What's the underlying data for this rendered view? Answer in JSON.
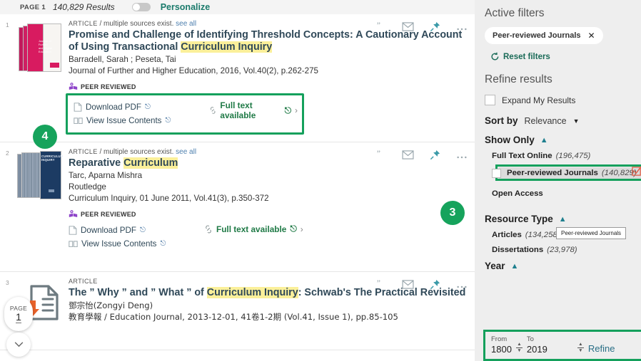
{
  "topbar": {
    "page_label": "PAGE 1",
    "results_count": "140,829 Results",
    "personalize_label": "Personalize",
    "toggle_state": "off"
  },
  "results": [
    {
      "index": "1",
      "kicker_type": "ARTICLE",
      "kicker_sep": "/ multiple sources exist.",
      "kicker_link": "see all",
      "title_pre": "Promise and Challenge of Identifying Threshold Concepts: A Cautionary Account of Using Transactional ",
      "title_highlight": "Curriculum Inquiry",
      "title_post": "",
      "authors": "Barradell, Sarah ; Peseta, Tai",
      "publisher": "",
      "source": "Journal of Further and Higher Education, 2016, Vol.40(2), p.262-275",
      "peer_reviewed_label": "PEER REVIEWED",
      "download_label": "Download PDF",
      "view_issue_label": "View Issue Contents",
      "fulltext_label": "Full text available",
      "highlighted": true
    },
    {
      "index": "2",
      "kicker_type": "ARTICLE",
      "kicker_sep": "/ multiple sources exist.",
      "kicker_link": "see all",
      "title_pre": "Reparative ",
      "title_highlight": "Curriculum",
      "title_post": "",
      "authors": "Tarc, Aparna Mishra",
      "publisher": "Routledge",
      "source": "Curriculum Inquiry, 01 June 2011, Vol.41(3), p.350-372",
      "peer_reviewed_label": "PEER REVIEWED",
      "download_label": "Download PDF",
      "view_issue_label": "View Issue Contents",
      "fulltext_label": "Full text available",
      "highlighted": false
    },
    {
      "index": "3",
      "kicker_type": "ARTICLE",
      "kicker_sep": "",
      "kicker_link": "",
      "title_pre": "The ” Why ” and ” What ” of ",
      "title_highlight": "Curriculum Inquiry",
      "title_post": ": Schwab's The Practical Revisited",
      "authors": "鄧宗怡(Zongyi Deng)",
      "publisher": "",
      "source": "教育學報 / Education Journal, 2013-12-01, 41卷1-2期 (Vol.41, Issue 1), pp.85-105",
      "peer_reviewed_label": "",
      "download_label": "",
      "view_issue_label": "",
      "fulltext_label": "",
      "highlighted": false
    }
  ],
  "annotations": {
    "badge_4": "4",
    "badge_3": "3"
  },
  "page_pill": {
    "word": "PAGE",
    "number": "1"
  },
  "sidebar": {
    "active_filters_title": "Active filters",
    "active_chip": "Peer-reviewed Journals",
    "chip_close": "✕",
    "reset_label": "Reset filters",
    "refine_title": "Refine results",
    "expand_label": "Expand My Results",
    "sort_by_label": "Sort by",
    "sort_by_value": "Relevance",
    "show_only": {
      "header": "Show Only",
      "items": [
        {
          "name": "Full Text Online",
          "count": "(196,475)",
          "selected": false,
          "highlighted": false
        },
        {
          "name": "Peer-reviewed Journals",
          "count": "(140,829)",
          "selected": true,
          "highlighted": true
        },
        {
          "name": "Open Access",
          "count": "",
          "selected": false,
          "highlighted": false
        }
      ],
      "tooltip": "Peer-reviewed Journals"
    },
    "resource_type": {
      "header": "Resource Type",
      "items": [
        {
          "name": "Articles",
          "count": "(134,258)"
        },
        {
          "name": "Dissertations",
          "count": "(23,978)"
        }
      ]
    },
    "year": {
      "header": "Year",
      "from_label": "From",
      "from_value": "1800",
      "to_label": "To",
      "to_value": "2019",
      "refine_label": "Refine"
    }
  },
  "colors": {
    "accent_green": "#14a05c",
    "badge_green": "#16a35c",
    "teal_link": "#1a7a6b",
    "title_blue": "#2f4858",
    "highlight_yellow": "#fbf09a",
    "sidebar_bg": "#eeeeee",
    "peer_purple": "#7e3fbf"
  }
}
